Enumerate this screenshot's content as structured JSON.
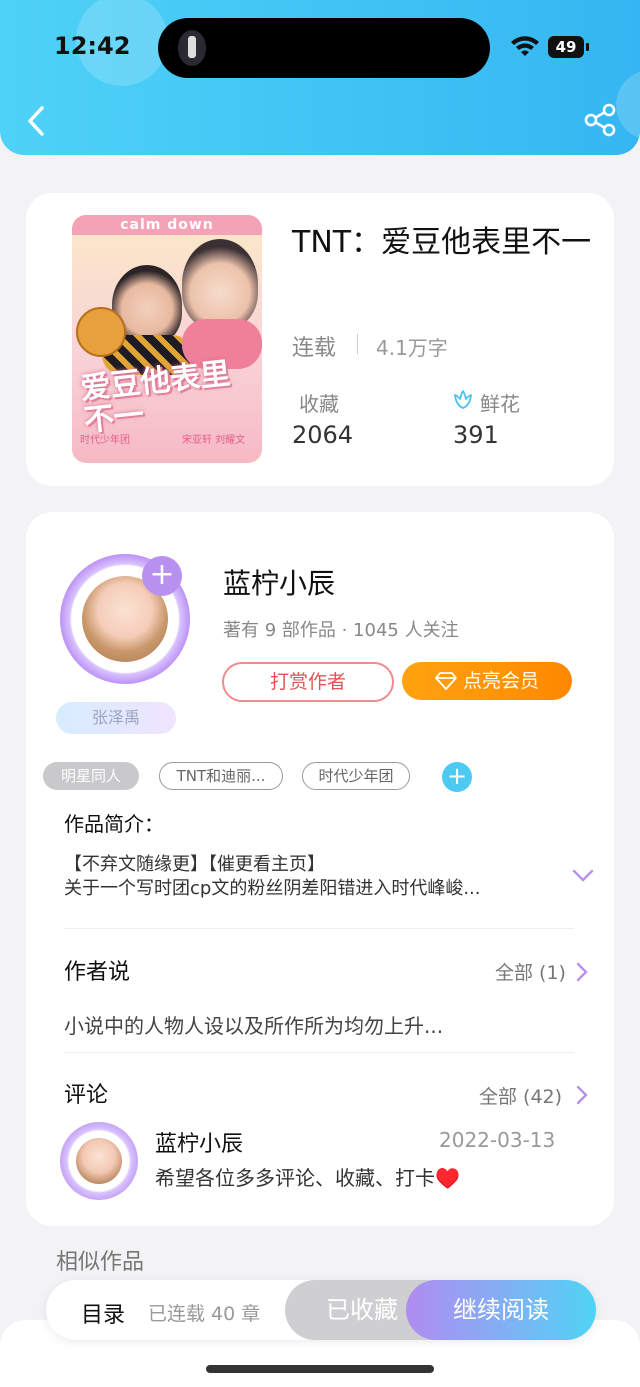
{
  "status_bar": {
    "time": "12:42",
    "battery": "49"
  },
  "book": {
    "title": "TNT：爱豆他表里不一",
    "status": "连载",
    "word_count": "4.1万字",
    "favorites_label": "收藏",
    "favorites_count": "2064",
    "flowers_label": "鲜花",
    "flowers_count": "391",
    "cover": {
      "top_text": "calm down",
      "title_art": "爱豆他表里不一",
      "sub_left": "时代少年团",
      "sub_right": "宋亚轩 刘耀文"
    }
  },
  "author": {
    "name": "蓝柠小辰",
    "meta": "著有 9 部作品 · 1045 人关注",
    "tag": "张泽禹",
    "tip_label": "打赏作者",
    "vip_label": "点亮会员",
    "follow_symbol": "+"
  },
  "tags": [
    "明星同人",
    "TNT和迪丽...",
    "时代少年团"
  ],
  "add_tag_symbol": "+",
  "intro": {
    "title": "作品简介：",
    "line1": "【不弃文随缘更】【催更看主页】",
    "line2": "关于一个写时团cp文的粉丝阴差阳错进入时代峰峻..."
  },
  "author_say": {
    "title": "作者说",
    "more": "全部 (1)",
    "text": "小说中的人物人设以及所作所为均勿上升..."
  },
  "comments": {
    "title": "评论",
    "more": "全部 (42)",
    "items": [
      {
        "name": "蓝柠小辰",
        "date": "2022-03-13",
        "text": "希望各位多多评论、收藏、打卡♥️"
      }
    ]
  },
  "similar_title": "相似作品",
  "bottom": {
    "toc": "目录",
    "chapters": "已连载 40 章",
    "collected": "已收藏",
    "continue": "继续阅读"
  },
  "colors": {
    "header_start": "#4fd2f7",
    "header_end": "#35b6f2",
    "vip_orange": "#ff8800",
    "tip_red": "#e15454",
    "accent_purple": "#b891f0"
  }
}
